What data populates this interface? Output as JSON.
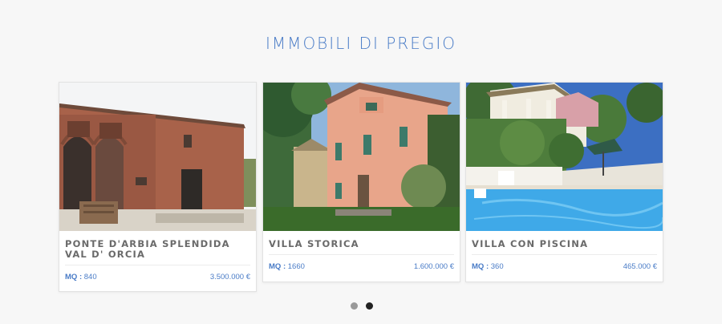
{
  "section": {
    "title": "IMMOBILI DI PREGIO"
  },
  "listings": [
    {
      "title": "PONTE D'ARBIA SPLENDIDA VAL D' ORCIA",
      "mq_label": "MQ :",
      "mq": "840",
      "price": "3.500.000 €",
      "image": "brick-farmhouse-photo"
    },
    {
      "title": "VILLA STORICA",
      "mq_label": "MQ :",
      "mq": "1660",
      "price": "1.600.000 €",
      "image": "pink-villa-photo"
    },
    {
      "title": "VILLA CON PISCINA",
      "mq_label": "MQ :",
      "mq": "360",
      "price": "465.000 €",
      "image": "villa-pool-photo"
    }
  ],
  "carousel": {
    "pages": 2,
    "active_page": 2
  },
  "colors": {
    "accent": "#4a7cc7",
    "title_gray": "#6a6a6a",
    "dot_active": "#222222",
    "dot_inactive": "#999999"
  }
}
